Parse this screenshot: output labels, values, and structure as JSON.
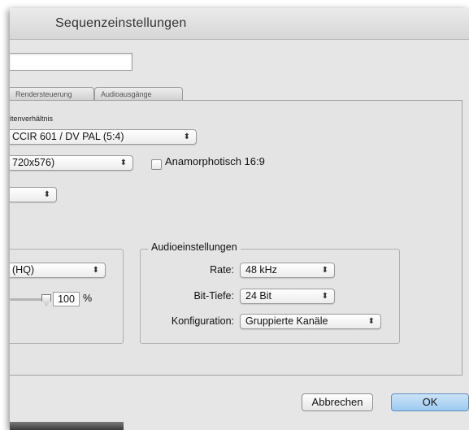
{
  "window": {
    "title": "Sequenzeinstellungen"
  },
  "tabs": [
    {
      "label": "Rendersteuerung"
    },
    {
      "label": "Audioausgänge"
    }
  ],
  "video": {
    "aspect_label": "itenverhältnis",
    "aspect_value": "CCIR 601 / DV PAL (5:4)",
    "frame_size_value": "720x576)",
    "anamorphic_label": "Anamorphotisch 16:9",
    "third_popup_value": "",
    "codec_value": "(HQ)",
    "quality_percent": "100",
    "percent_sign": "%"
  },
  "audio": {
    "group_title": "Audioeinstellungen",
    "rate_label": "Rate:",
    "rate_value": "48 kHz",
    "bitdepth_label": "Bit-Tiefe:",
    "bitdepth_value": "24 Bit",
    "config_label": "Konfiguration:",
    "config_value": "Gruppierte Kanäle"
  },
  "buttons": {
    "cancel": "Abbrechen",
    "ok": "OK"
  },
  "colors": {
    "window_bg": "#e6e6e6",
    "default_button": "#9ccaf0"
  }
}
